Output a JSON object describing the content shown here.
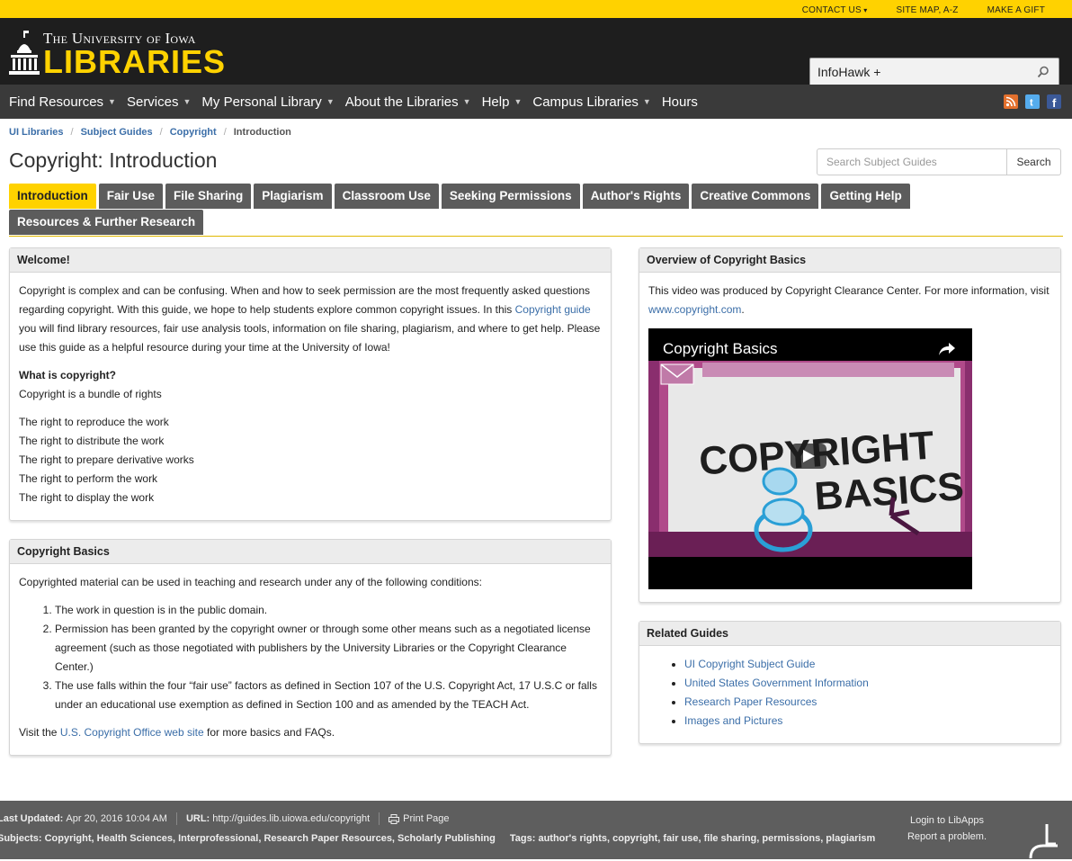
{
  "toplinks": {
    "contact": "CONTACT US",
    "sitemap": "SITE MAP, A-Z",
    "gift": "MAKE A GIFT"
  },
  "logo": {
    "small": "The University of Iowa",
    "big": "LIBRARIES"
  },
  "infohawk": {
    "label": "InfoHawk +"
  },
  "nav": {
    "items": [
      "Find Resources",
      "Services",
      "My Personal Library",
      "About the Libraries",
      "Help",
      "Campus Libraries",
      "Hours"
    ]
  },
  "colors": {
    "gold": "#ffd200",
    "dark": "#1e1e1e",
    "nav": "#3a3a3a",
    "tab": "#5c5c5c",
    "link": "#3b6ea8"
  },
  "breadcrumb": [
    "UI Libraries",
    "Subject Guides",
    "Copyright",
    "Introduction"
  ],
  "page_title": "Copyright: Introduction",
  "subject_search": {
    "placeholder": "Search Subject Guides",
    "button": "Search"
  },
  "tabs": [
    "Introduction",
    "Fair Use",
    "File Sharing",
    "Plagiarism",
    "Classroom Use",
    "Seeking Permissions",
    "Author's Rights",
    "Creative Commons",
    "Getting Help",
    "Resources & Further Research"
  ],
  "welcome": {
    "title": "Welcome!",
    "p1a": "Copyright is complex and can be confusing.  When and how to seek permission are the most frequently asked questions regarding copyright. With this guide, we hope to help students explore common copyright issues.  In this ",
    "p1link": "Copyright guide",
    "p1b": " you will find library resources, fair use analysis tools, information on file sharing, plagiarism, and where to get help.  Please use this guide as a helpful resource during your time at the University of Iowa!",
    "q": "What is copyright?",
    "q_answer": "Copyright is a bundle of rights",
    "rights": [
      "The right to reproduce the work",
      "The right to distribute the work",
      "The right to prepare derivative works",
      "The right to perform the work",
      "The right to display the work"
    ]
  },
  "basics": {
    "title": "Copyright Basics",
    "intro": "Copyrighted material can be used in teaching and research under any of the following conditions:",
    "items": [
      "The work in question is in the public domain.",
      "Permission has been granted by the copyright owner or through some other means such as a negotiated license agreement (such as those negotiated with publishers by the University Libraries or the Copyright Clearance Center.)",
      "The use falls within the four “fair use” factors as defined in Section 107 of the U.S. Copyright Act, 17 U.S.C or falls under an educational use exemption as defined in Section 100 and as amended by the TEACH Act."
    ],
    "visit_a": "Visit the ",
    "visit_link": "U.S. Copyright Office web site",
    "visit_b": " for more basics and FAQs."
  },
  "overview": {
    "title": "Overview of Copyright Basics",
    "text_a": "This video was produced by Copyright Clearance Center. For more information, visit ",
    "link": "www.copyright.com",
    "text_b": ".",
    "video_title": "Copyright Basics",
    "video_art_line1": "COPYRIGHT",
    "video_art_line2": "BASICS"
  },
  "related": {
    "title": "Related Guides",
    "items": [
      "UI Copyright Subject Guide",
      "United States Government Information",
      "Research Paper Resources",
      "Images and Pictures"
    ]
  },
  "footer": {
    "updated_label": "Last Updated:",
    "updated_value": "Apr 20, 2016 10:04 AM",
    "url_label": "URL:",
    "url_value": "http://guides.lib.uiowa.edu/copyright",
    "print": "Print Page",
    "subjects_label": "Subjects:",
    "subjects_value": "Copyright, Health Sciences, Interprofessional, Research Paper Resources, Scholarly Publishing",
    "tags_label": "Tags:",
    "tags_value": "author's rights, copyright, fair use, file sharing, permissions, plagiarism",
    "login": "Login to LibApps",
    "report": "Report a problem."
  }
}
